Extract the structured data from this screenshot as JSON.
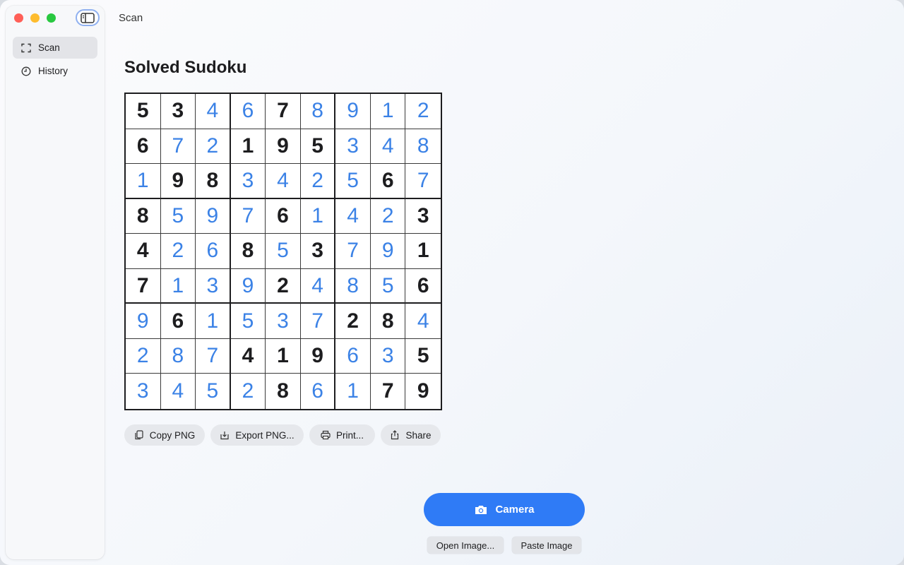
{
  "window": {
    "title": "Scan"
  },
  "sidebar": {
    "items": [
      {
        "label": "Scan",
        "icon": "scan-frame-icon",
        "active": true
      },
      {
        "label": "History",
        "icon": "clock-icon",
        "active": false
      }
    ]
  },
  "main": {
    "heading": "Solved Sudoku",
    "grid": [
      [
        5,
        3,
        4,
        6,
        7,
        8,
        9,
        1,
        2
      ],
      [
        6,
        7,
        2,
        1,
        9,
        5,
        3,
        4,
        8
      ],
      [
        1,
        9,
        8,
        3,
        4,
        2,
        5,
        6,
        7
      ],
      [
        8,
        5,
        9,
        7,
        6,
        1,
        4,
        2,
        3
      ],
      [
        4,
        2,
        6,
        8,
        5,
        3,
        7,
        9,
        1
      ],
      [
        7,
        1,
        3,
        9,
        2,
        4,
        8,
        5,
        6
      ],
      [
        9,
        6,
        1,
        5,
        3,
        7,
        2,
        8,
        4
      ],
      [
        2,
        8,
        7,
        4,
        1,
        9,
        6,
        3,
        5
      ],
      [
        3,
        4,
        5,
        2,
        8,
        6,
        1,
        7,
        9
      ]
    ],
    "given": [
      [
        1,
        1,
        0,
        0,
        1,
        0,
        0,
        0,
        0
      ],
      [
        1,
        0,
        0,
        1,
        1,
        1,
        0,
        0,
        0
      ],
      [
        0,
        1,
        1,
        0,
        0,
        0,
        0,
        1,
        0
      ],
      [
        1,
        0,
        0,
        0,
        1,
        0,
        0,
        0,
        1
      ],
      [
        1,
        0,
        0,
        1,
        0,
        1,
        0,
        0,
        1
      ],
      [
        1,
        0,
        0,
        0,
        1,
        0,
        0,
        0,
        1
      ],
      [
        0,
        1,
        0,
        0,
        0,
        0,
        1,
        1,
        0
      ],
      [
        0,
        0,
        0,
        1,
        1,
        1,
        0,
        0,
        1
      ],
      [
        0,
        0,
        0,
        0,
        1,
        0,
        0,
        1,
        1
      ]
    ],
    "actions": {
      "copy_png": "Copy PNG",
      "export_png": "Export PNG...",
      "print": "Print...",
      "share": "Share"
    },
    "camera_label": "Camera",
    "open_image_label": "Open Image...",
    "paste_image_label": "Paste Image"
  },
  "colors": {
    "given_digit": "#1d1d1f",
    "solved_digit": "#3b82e6",
    "accent": "#2f7bf6"
  }
}
